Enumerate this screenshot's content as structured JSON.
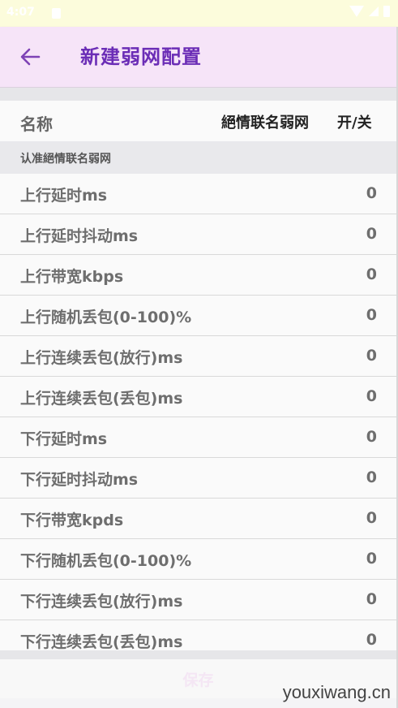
{
  "status_bar": {
    "time": "4:07"
  },
  "app_bar": {
    "title": "新建弱网配置"
  },
  "header": {
    "name_label": "名称",
    "name_value": "絕情联名弱网",
    "toggle_label": "开/关"
  },
  "section": {
    "title": "认准絕情联名弱网"
  },
  "rows": [
    {
      "label": "上行延时ms",
      "value": "0"
    },
    {
      "label": "上行延时抖动ms",
      "value": "0"
    },
    {
      "label": "上行带宽kbps",
      "value": "0"
    },
    {
      "label": "上行随机丢包(0-100)%",
      "value": "0"
    },
    {
      "label": "上行连续丢包(放行)ms",
      "value": "0"
    },
    {
      "label": "上行连续丢包(丢包)ms",
      "value": "0"
    },
    {
      "label": "下行延时ms",
      "value": "0"
    },
    {
      "label": "下行延时抖动ms",
      "value": "0"
    },
    {
      "label": "下行带宽kpds",
      "value": "0"
    },
    {
      "label": "下行随机丢包(0-100)%",
      "value": "0"
    },
    {
      "label": "下行连续丢包(放行)ms",
      "value": "0"
    },
    {
      "label": "下行连续丢包(丢包)ms",
      "value": "0"
    }
  ],
  "save_label": "保存",
  "watermark": "youxiwang.cn",
  "colors": {
    "app_bar_bg": "#f6e4f8",
    "accent": "#6b2db6",
    "status_bar_bg": "#fcfcdc"
  }
}
